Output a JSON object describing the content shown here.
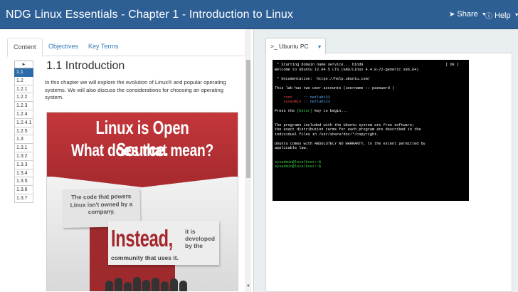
{
  "header": {
    "title": "NDG Linux Essentials - Chapter 1 - Introduction to Linux",
    "share_label": "Share",
    "help_label": "Help",
    "share_icon": "share-icon",
    "help_icon": "help-icon"
  },
  "left": {
    "tabs": [
      {
        "label": "Content"
      },
      {
        "label": "Objectives"
      },
      {
        "label": "Key Terms"
      }
    ],
    "toc": [
      "1.1",
      "1.2",
      "1.2.1",
      "1.2.2",
      "1.2.3",
      "1.2.4",
      "1.2.4.1",
      "1.2.5",
      "1.3",
      "1.3.1",
      "1.3.2",
      "1.3.3",
      "1.3.4",
      "1.3.5",
      "1.3.6",
      "1.3.7"
    ],
    "toc_active": "1.1",
    "heading": "1.1 Introduction",
    "paragraph": "In this chapter we will explore the evolution of Linux® and popular operating systems. We will also discuss the considerations for choosing an operating system.",
    "poster": {
      "line1": "Linux is Open Source.",
      "line2": "What does that mean?",
      "card1": "The code that powers Linux isn't owned by a company.",
      "instead": "Instead,",
      "itis": "it is developed by the",
      "community": "community that uses it."
    }
  },
  "right": {
    "tab_label": ">_ Ubuntu PC",
    "terminal": {
      "ok": "[ OK ]",
      "l1": " * Starting domain name service... bind9",
      "l2": "Welcome to Ubuntu 12.04.5 LTS (GNU/Linux 4.4.0-72-generic x86_64)",
      "l3": " * Documentation:  https://help.ubuntu.com/",
      "l4": "This lab has two user accounts (username :: password )",
      "u1_name": "root",
      "u1_pass": " :: netlab123",
      "u2_name": "sysadmin",
      "u2_pass": " :: netlab123",
      "l5_pre": "Press the ",
      "l5_key": "[Enter]",
      "l5_post": " key to begin...",
      "l6": "The programs included with the Ubuntu system are free software;",
      "l7": "the exact distribution terms for each program are described in the",
      "l8": "individual files in /usr/share/doc/*/copyright.",
      "l9": "Ubuntu comes with ABSOLUTELY NO WARRANTY, to the extent permitted by",
      "l10": "applicable law.",
      "prompt1": "sysadmin@localhost:~$",
      "prompt2": "sysadmin@localhost:~$"
    }
  }
}
